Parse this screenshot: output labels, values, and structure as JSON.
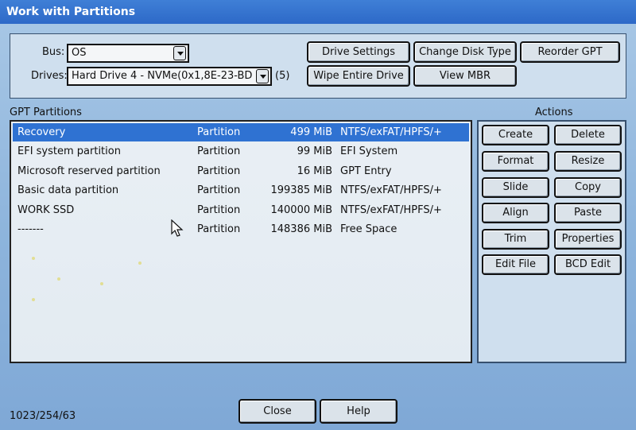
{
  "window": {
    "title": "Work with Partitions"
  },
  "bus": {
    "label": "Bus:",
    "value": "OS"
  },
  "drives": {
    "label": "Drives:",
    "value": "Hard Drive 4 - NVMe(0x1,8E-23-BD",
    "count": "(5)"
  },
  "top_buttons": {
    "drive_settings": "Drive Settings",
    "change_disk_type": "Change Disk Type",
    "reorder_gpt": "Reorder GPT",
    "wipe_entire_drive": "Wipe Entire Drive",
    "view_mbr": "View MBR"
  },
  "partitions": {
    "header": "GPT Partitions",
    "rows": [
      {
        "name": "Recovery",
        "type": "Partition",
        "size": "499 MiB",
        "fs": "NTFS/exFAT/HPFS/+"
      },
      {
        "name": "EFI system partition",
        "type": "Partition",
        "size": "99 MiB",
        "fs": "EFI System"
      },
      {
        "name": "Microsoft reserved partition",
        "type": "Partition",
        "size": "16 MiB",
        "fs": "GPT Entry"
      },
      {
        "name": "Basic data partition",
        "type": "Partition",
        "size": "199385 MiB",
        "fs": "NTFS/exFAT/HPFS/+"
      },
      {
        "name": "WORK SSD",
        "type": "Partition",
        "size": "140000 MiB",
        "fs": "NTFS/exFAT/HPFS/+"
      },
      {
        "name": "-------",
        "type": "Partition",
        "size": "148386 MiB",
        "fs": "Free Space"
      }
    ]
  },
  "actions": {
    "header": "Actions",
    "create": "Create",
    "delete": "Delete",
    "format": "Format",
    "resize": "Resize",
    "slide": "Slide",
    "copy": "Copy",
    "align": "Align",
    "paste": "Paste",
    "trim": "Trim",
    "properties": "Properties",
    "edit_file": "Edit File",
    "bcd_edit": "BCD Edit"
  },
  "footer": {
    "geometry": "1023/254/63",
    "close": "Close",
    "help": "Help"
  }
}
